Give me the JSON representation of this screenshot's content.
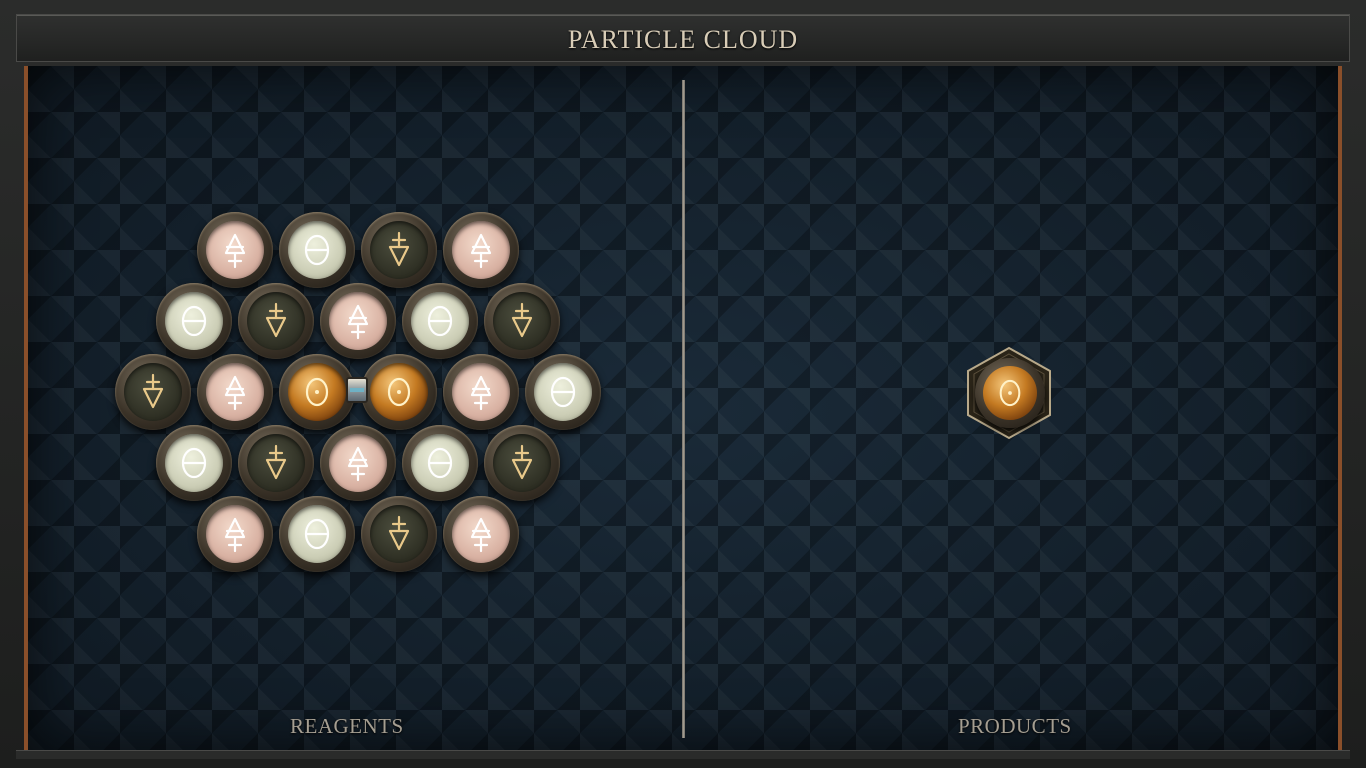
{
  "window": {
    "title": "PARTICLE CLOUD"
  },
  "panels": {
    "reagents_label": "REAGENTS",
    "products_label": "PRODUCTS"
  },
  "elements": {
    "air": {
      "name": "air",
      "icon": "air-element-icon",
      "color": "#d9b2a3",
      "glyph_color": "#ffffff"
    },
    "salt": {
      "name": "salt",
      "icon": "salt-element-icon",
      "color": "#ccceb6",
      "glyph_color": "#ffffff"
    },
    "earth": {
      "name": "earth",
      "icon": "earth-element-icon",
      "color": "#313226",
      "glyph_color": "#e9c98a"
    },
    "gold": {
      "name": "gold",
      "icon": "gold-element-icon",
      "color": "#c47a22",
      "glyph_color": "#fff2c8"
    }
  },
  "reagent_rows": [
    [
      "air",
      "salt",
      "earth",
      "air"
    ],
    [
      "salt",
      "earth",
      "air",
      "salt",
      "earth"
    ],
    [
      "earth",
      "air",
      "gold",
      "gold",
      "air",
      "salt"
    ],
    [
      "salt",
      "earth",
      "air",
      "salt",
      "earth"
    ],
    [
      "air",
      "salt",
      "earth",
      "air"
    ]
  ],
  "reagent_bonds": [
    {
      "row": 2,
      "from": 2,
      "to": 3
    }
  ],
  "products": [
    "gold"
  ]
}
